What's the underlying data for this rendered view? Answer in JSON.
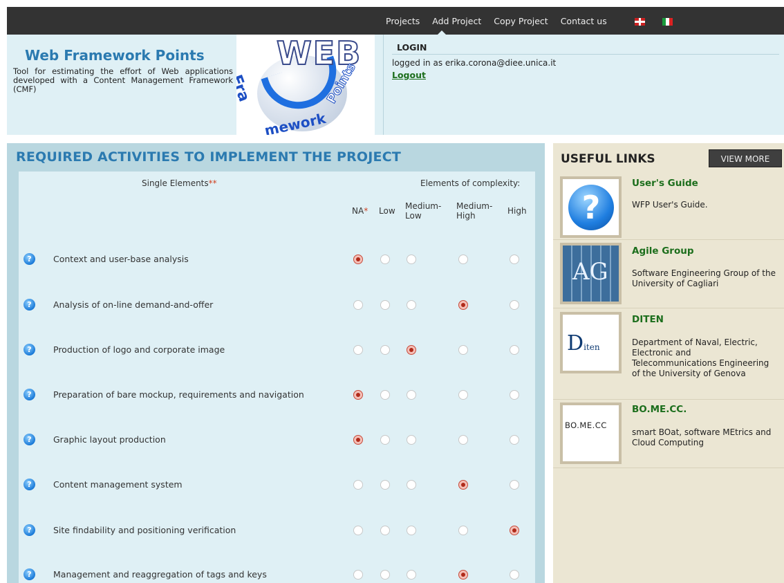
{
  "nav": {
    "items": [
      "Projects",
      "Add Project",
      "Copy Project",
      "Contact us"
    ],
    "flags": [
      "uk-flag-icon",
      "italy-flag-icon"
    ]
  },
  "header": {
    "title": "Web Framework Points",
    "description": "Tool for estimating the effort of Web applications developed with a Content Management Framework (CMF)",
    "logo": {
      "web": "WEB",
      "framework": "Fra",
      "work": "mework",
      "points": "Points"
    }
  },
  "login": {
    "title": "LOGIN",
    "status": "logged in as erika.corona@diee.unica.it",
    "logout": "Logout"
  },
  "main": {
    "title": "REQUIRED ACTIVITIES TO IMPLEMENT THE PROJECT",
    "single_elements": "Single Elements",
    "single_elements_mark": "**",
    "complexity_label": "Elements of complexity:",
    "columns": {
      "na": "NA",
      "na_mark": "*",
      "low": "Low",
      "medium_low_1": "Medium-",
      "medium_low_2": "Low",
      "medium_high_1": "Medium-",
      "medium_high_2": "High",
      "high": "High"
    },
    "info_icon_glyph": "?",
    "rows": [
      {
        "label": "Context and user-base analysis",
        "selected": 0
      },
      {
        "label": "Analysis of on-line demand-and-offer",
        "selected": 3
      },
      {
        "label": "Production of logo and corporate image",
        "selected": 2
      },
      {
        "label": "Preparation of bare mockup, requirements and navigation",
        "selected": 0
      },
      {
        "label": "Graphic layout production",
        "selected": 0
      },
      {
        "label": "Content management system",
        "selected": 3
      },
      {
        "label": "Site findability and positioning verification",
        "selected": 4
      },
      {
        "label": "Management and reaggregation of tags and keys",
        "selected": 3
      }
    ]
  },
  "sidebar": {
    "title": "USEFUL LINKS",
    "view_more": "VIEW MORE",
    "links": [
      {
        "title": "User's Guide",
        "desc": "WFP User's Guide.",
        "thumb": "?"
      },
      {
        "title": "Agile Group",
        "desc": "Software Engineering Group of the University of Cagliari",
        "thumb": "AG"
      },
      {
        "title": "DITEN",
        "desc": "Department of Naval, Electric, Electronic and Telecommunications Engineering of the University of Genova",
        "thumb_big": "D",
        "thumb": "iten"
      },
      {
        "title": "BO.ME.CC.",
        "desc": "smart BOat, software MEtrics and Cloud Computing",
        "thumb": "BO.ME.CC"
      }
    ]
  }
}
